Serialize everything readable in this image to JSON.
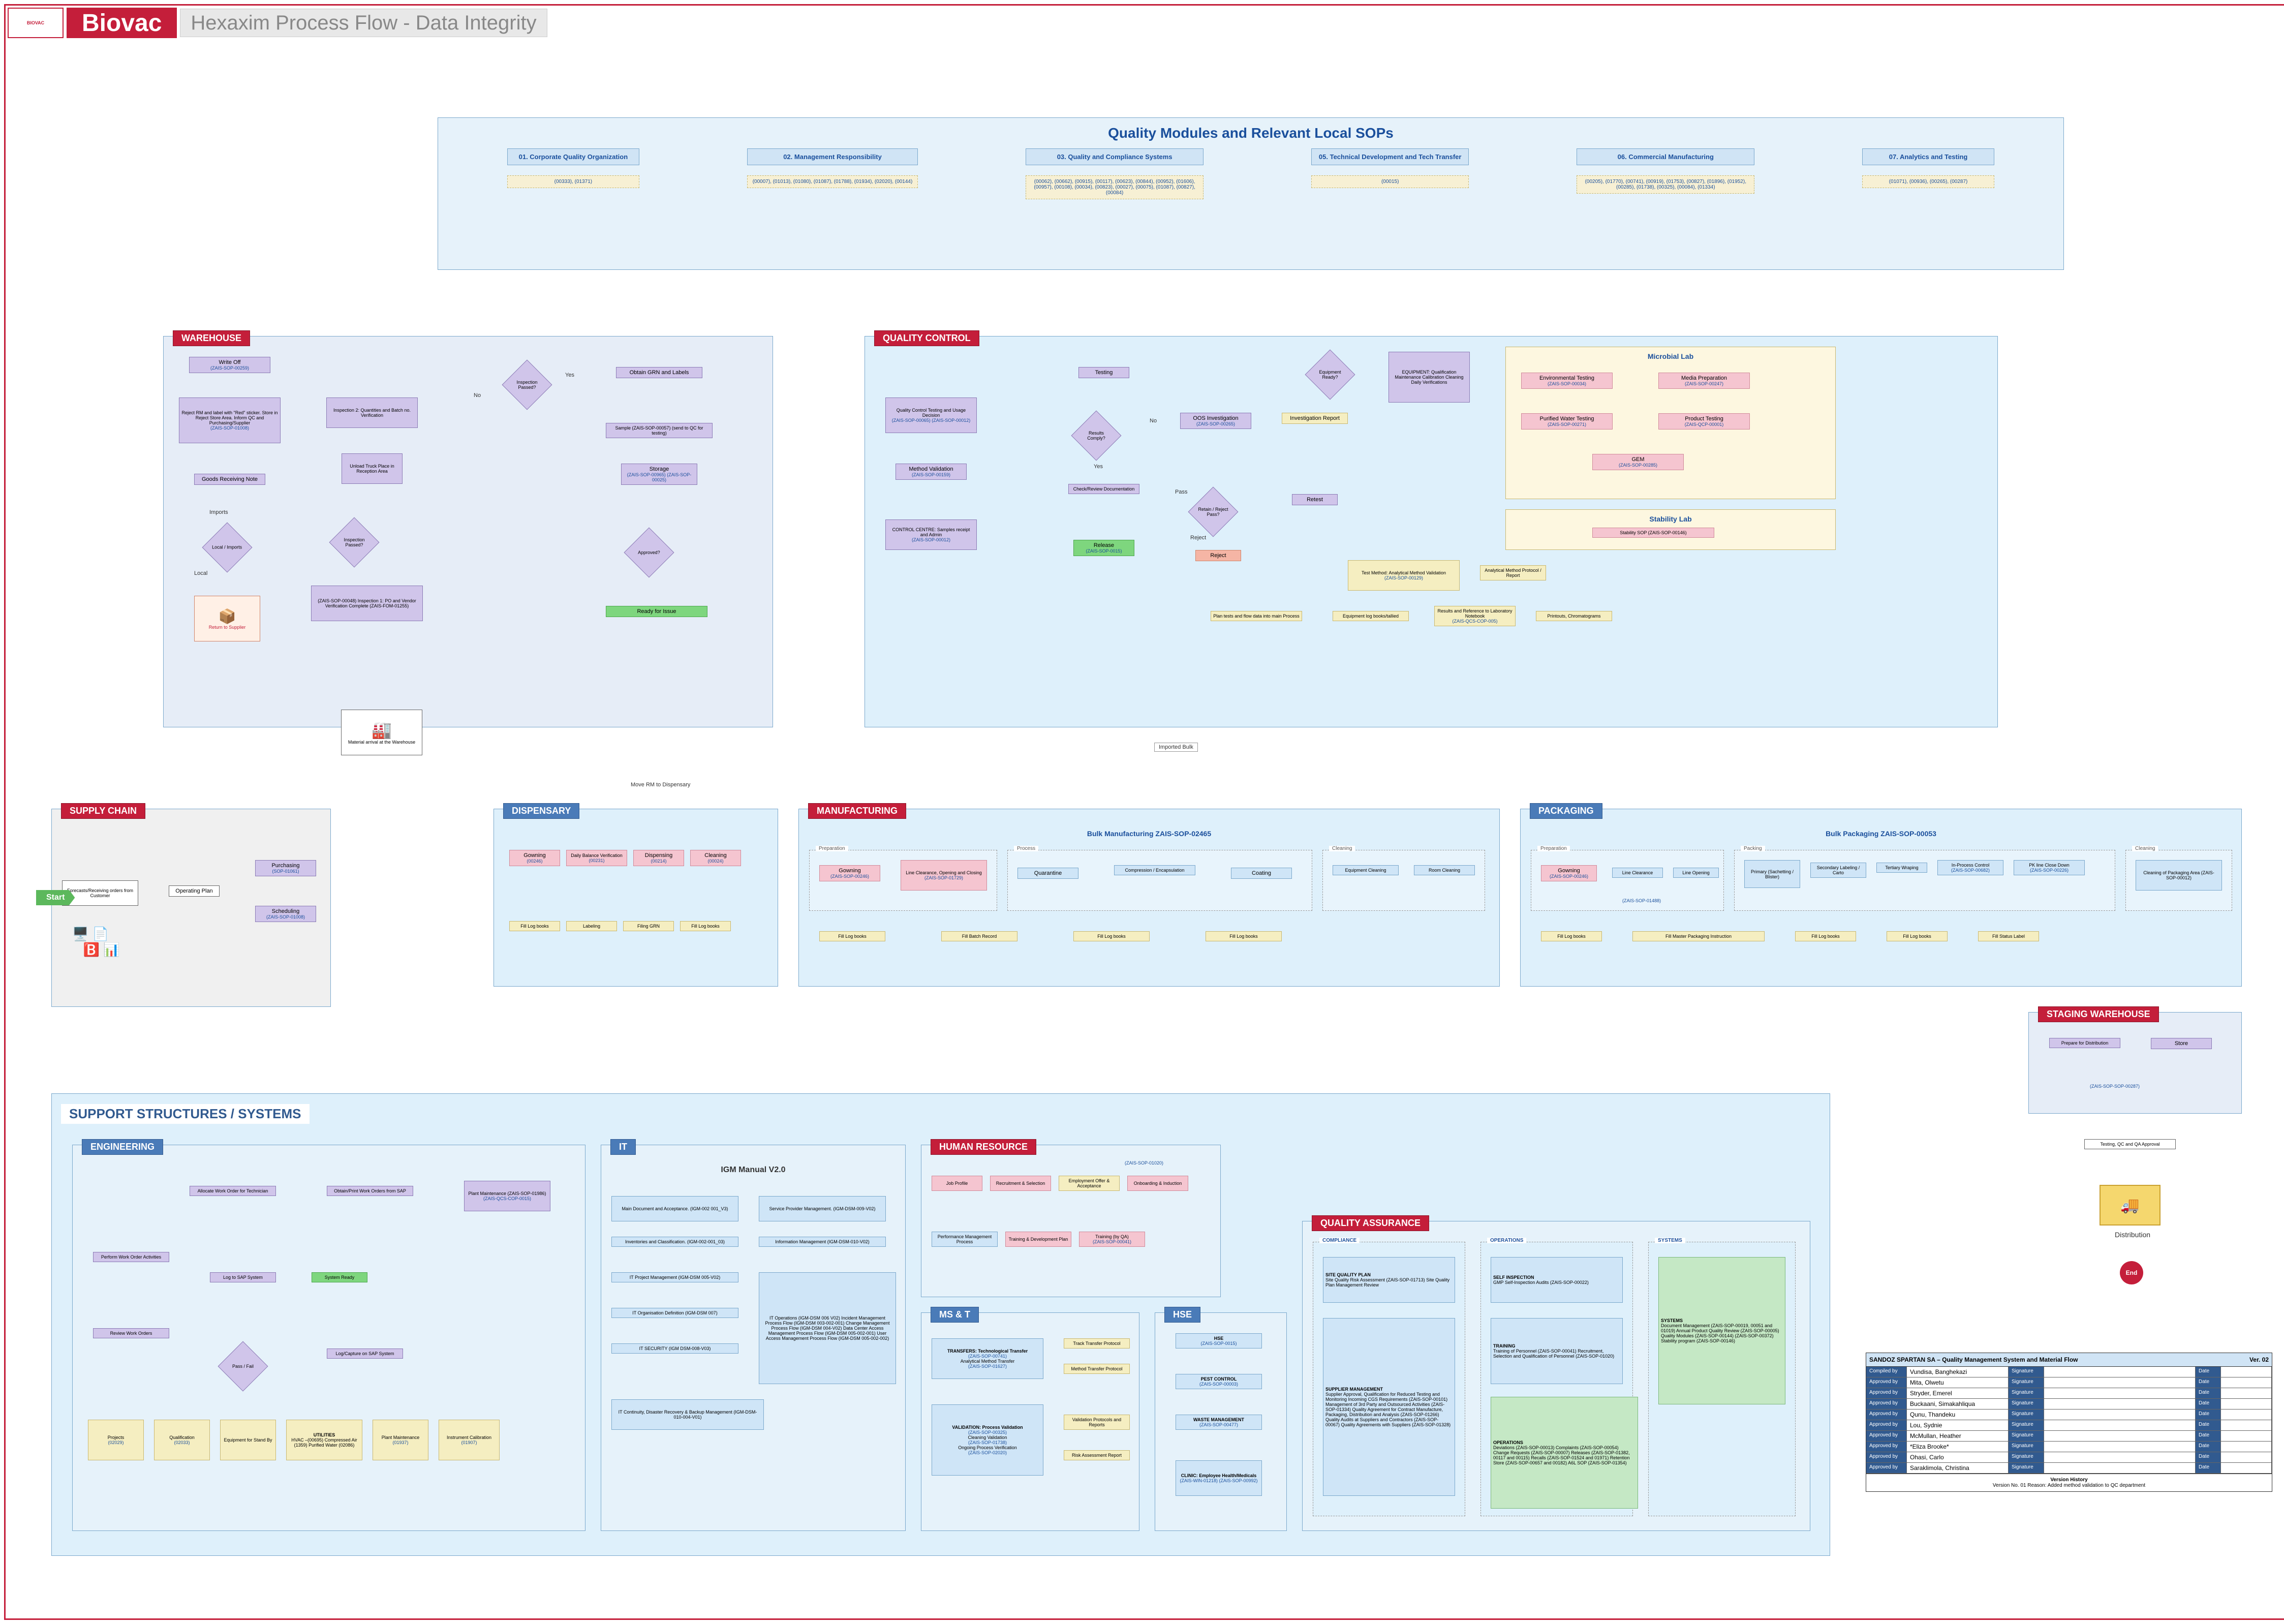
{
  "header": {
    "logo_text": "BIOVAC",
    "brand": "Biovac",
    "subtitle": "Hexaxim Process Flow - Data Integrity"
  },
  "qm": {
    "title": "Quality Modules and Relevant Local SOPs",
    "cols": [
      {
        "label": "01. Corporate Quality Organization",
        "sops": "(00333), (01371)"
      },
      {
        "label": "02. Management Responsibility",
        "sops": "(00007), (01013), (01080), (01087), (01788), (01934), (02020), (00144)"
      },
      {
        "label": "03. Quality and Compliance Systems",
        "sops": "(00062), (00662), (00915), (00117), (00623), (00844), (00952), (01606), (00957), (00108), (00034), (00823), (00027), (00075), (01087), (00827), (00084)"
      },
      {
        "label": "05. Technical Development and Tech Transfer",
        "sops": "(00015)"
      },
      {
        "label": "06. Commercial Manufacturing",
        "sops": "(00205), (01770), (00741), (00919), (01753), (00827), (01896), (01952), (00285), (01738), (00325), (00084), (01334)"
      },
      {
        "label": "07. Analytics and Testing",
        "sops": "(01071), (00936), (00265), (00287)"
      }
    ]
  },
  "areas": {
    "warehouse": "WAREHOUSE",
    "qc": "QUALITY CONTROL",
    "sc": "SUPPLY CHAIN",
    "disp": "DISPENSARY",
    "manu": "MANUFACTURING",
    "pkg": "PACKAGING",
    "stgwh": "STAGING WAREHOUSE",
    "support": "SUPPORT STRUCTURES / SYSTEMS",
    "eng": "ENGINEERING",
    "it": "IT",
    "hr": "HUMAN RESOURCE",
    "mst": "MS & T",
    "hse": "HSE",
    "qa": "QUALITY ASSURANCE"
  },
  "warehouse": {
    "writeoff": "Write Off",
    "writeoff_sop": "(ZAIS-SOP-00259)",
    "reject": "Reject RM and label with \"Red\" sticker. Store in Reject Store Area. Inform QC and Purchasing/Supplier",
    "reject_sop": "(ZAIS-SOP-01008)",
    "insp2": "Inspection 2: Quantities and Batch no. Verification",
    "unload": "Unload Truck Place in Reception Area",
    "insp_dia": "Inspection Passed?",
    "insp2_dia": "Inspection Passed?",
    "obtain": "Obtain GRN and Labels",
    "sample": "Sample (ZAIS-SOP-00057) (send to QC for testing)",
    "storage": "Storage",
    "storage_sop": "(ZAIS-SOP-00965)\n(ZAIS-SOP-00025)",
    "approved_dia": "Approved?",
    "ready": "Ready for Issue",
    "grn": "Goods Receiving Note",
    "local_dia": "Local / Imports",
    "insp1": "(ZAIS-SOP-00048) Inspection 1: PO and Vendor Verification Complete (ZAIS-FOM-01255)",
    "return": "Return to Supplier",
    "material": "Material arrival at the Warehouse",
    "imports": "Imports",
    "local": "Local",
    "yes": "Yes",
    "no": "No",
    "move_rm": "Move RM to Dispensary"
  },
  "qc": {
    "qct": "Quality Control Testing and Usage Decision",
    "qct_sop": "(ZAIS-SOP-00065)\n(ZAIS-SOP-00012)",
    "mv": "Method Validation",
    "mv_sop": "(ZAIS-SOP-00159)",
    "cc": "CONTROL CENTRE: Samples receipt and Admin",
    "cc_sop": "(ZAIS-SOP-00012)",
    "testing": "Testing",
    "results_dia": "Results Comply?",
    "oos": "OOS Investigation",
    "oos_sop": "(ZAIS-SOP-00265)",
    "checkrev": "Check/Review Documentation",
    "release": "Release",
    "release_sop": "(ZAIS-SOP-0015)",
    "retain_dia": "Retain / Reject Pass?",
    "reject": "Reject",
    "retest": "Retest",
    "inv_rep": "Investigation Report",
    "equip_dia": "Equipment Ready?",
    "equip": "EQUIPMENT: Qualification Maintenance Calibration Cleaning Daily Verifications",
    "microbial": "Microbial Lab",
    "env": "Environmental Testing",
    "env_sop": "(ZAIS-SOP-00034)",
    "media": "Media Preparation",
    "media_sop": "(ZAIS-SOP-00247)",
    "water": "Purified Water Testing",
    "water_sop": "(ZAIS-SOP-00271)",
    "product": "Product Testing",
    "product_sop": "(ZAIS-QCP-00001)",
    "gem": "GEM",
    "gem_sop": "(ZAIS-SOP-00285)",
    "stability": "Stability Lab",
    "stab_sop": "Stability SOP (ZAIS-SOP-00146)",
    "tm": "Test Method: Analytical Method Validation",
    "tm_sop": "(ZAIS-SOP-00129)",
    "ampr": "Analytical Method Protocol / Report",
    "plcf": "Plan tests and flow data into main Process",
    "logtied": "Equipment log books/tallied",
    "resref": "Results and Reference to Laboratory Notebook",
    "resref_sop": "(ZAIS-QCS-COP-005)",
    "printouts": "Printouts, Chromatograms",
    "pass": "Pass",
    "reject_lbl": "Reject",
    "yes": "Yes",
    "no": "No",
    "imported_bulk": "Imported Bulk"
  },
  "sc": {
    "forecast": "Forecasts/Receiving orders from Customer",
    "op": "Operating Plan",
    "purch": "Purchasing",
    "purch_sop": "(SOP-01061)",
    "sched": "Scheduling",
    "sched_sop": "(ZAIS-SOP-01008)"
  },
  "disp": {
    "gowning": "Gowning",
    "gowning_sop": "(00246)",
    "bal": "Daily Balance Verification",
    "bal_sop": "(00231)",
    "disp": "Dispensing",
    "disp_sop": "(00214)",
    "clean": "Cleaning",
    "clean_sop": "(00024)",
    "logs": "Fill Log books",
    "label": "Labeling",
    "filing": "Filing GRN",
    "logs2": "Fill Log books"
  },
  "manu": {
    "title": "Bulk Manufacturing ZAIS-SOP-02465",
    "prep": "Preparation",
    "process": "Process",
    "cleaning": "Cleaning",
    "gowning": "Gowning",
    "gowning_sop": "(ZAIS-SOP-00246)",
    "lc": "Line Clearance, Opening and Closing",
    "lc_sop": "(ZAIS-SOP-01729)",
    "quar": "Quarantine",
    "press": "Compression / Encapsulation",
    "coat": "Coating",
    "eqclean": "Equipment Cleaning",
    "rmclean": "Room Cleaning",
    "logs": "Fill Log books",
    "batch": "Fill Batch Record",
    "logs2": "Fill Log books",
    "logs3": "Fill Log books"
  },
  "pkg": {
    "title": "Bulk Packaging ZAIS-SOP-00053",
    "prep": "Preparation",
    "packing": "Packing",
    "cleaning": "Cleaning",
    "gowning": "Gowning",
    "gowning_sop": "(ZAIS-SOP-00246)",
    "lc": "Line Clearance",
    "open": "Line Opening",
    "lc_sop": "(ZAIS-SOP-01488)",
    "primary": "Primary (Sachetting / Blister)",
    "secondary": "Secondary Labeling / Carto",
    "tertiary": "Tertiary Wraping",
    "ipc": "In-Process Control",
    "ipc_sop": "(ZAIS-SOP-00682)",
    "close": "PK line Close Down",
    "close_sop": "(ZAIS-SOP-00226)",
    "cleanpkg": "Cleaning of Packaging Area (ZAIS-SOP-00012)",
    "logs": "Fill Log books",
    "mpi": "Fill Master Packaging Instruction",
    "logs2": "Fill Log books",
    "logs3": "Fill Log books",
    "status": "Fill Status Label"
  },
  "stgwh": {
    "prep": "Prepare for Distribution",
    "store": "Store",
    "sop": "(ZAIS-SOP-SOP-00287)",
    "approval": "Testing, QC and QA Approval",
    "dist": "Distribution",
    "end": "End"
  },
  "eng": {
    "allocate": "Allocate Work Order for Technician",
    "obtain": "Obtain/Print Work Orders from SAP",
    "plan": "Plant Maintenance (ZAIS-SOP-01986)",
    "plan_sop": "(ZAIS-QCS-COP-0015)",
    "perform": "Perform Work Order Activities",
    "log": "Log to SAP System",
    "sysready": "System Ready",
    "review": "Review Work Orders",
    "pass_dia": "Pass / Fail",
    "capture": "Log/Capture on SAP System",
    "projects": "Projects",
    "projects_sop": "(02029)",
    "qual": "Qualification",
    "qual_sop": "(02033)",
    "equip": "Equipment for Stand By",
    "util": "UTILITIES",
    "util_detail": "HVAC –(00695) Compressed Air (1359) Purified Water (02086)",
    "pmaint": "Plant Maintenance",
    "pmaint_sop": "(01937)",
    "instcal": "Instrument Calibration",
    "instcal_sop": "(01907)"
  },
  "it": {
    "title": "IGM Manual V2.0",
    "main": "Main Document and Acceptance. (IGM-002 001_V3)",
    "spm": "Service Provider Management. (IGM-DSM-009-V02)",
    "inv": "Inventories and Classification. (IGM-002-001_03)",
    "info": "Information Management (IGM-DSM-010-V02)",
    "proj": "IT Project Management (IGM-DSM 005-V02)",
    "org": "IT Organisation Definition (IGM-DSM 007)",
    "sec": "IT SECURITY (IGM DSM-008-V03)",
    "ops": "IT Operations (IGM-DSM 006 V02) Incident Management Process Flow  (IGM-DSM 003-002-001) Change Management Process Flow (IGM-DSM 004-V02) Data Center Access Management Process Flow (IGM-DSM 005-002-001) User Access Management Process Flow (IGM-DSM 005-002-002)",
    "bcp": "IT Continuity, Disaster Recovery & Backup Management (IGM-DSM-010-004-V01)"
  },
  "hr": {
    "sop": "(ZAIS-SOP-01020)",
    "jp": "Job Profile",
    "rs": "Recruitment & Selection",
    "eo": "Employment Offer & Acceptance",
    "oi": "Onboarding & Induction",
    "pmp": "Performance Management Process",
    "tdp": "Training & Development Plan",
    "tq": "Training (by QA)",
    "tq_sop": "(ZAIS-SOP-00041)"
  },
  "mst": {
    "transfers": "TRANSFERS: Technological Transfer",
    "transfers_sop": "(ZAIS-SOP-00741)",
    "amt": "Analytical Method Transfer",
    "amt_sop": "(ZAIS-SOP-01627)",
    "vp": "Track Transfer Protocol",
    "mtp": "Method Transfer Protocol",
    "val": "VALIDATION: Process Validation",
    "val_sop": "(ZAIS-SOP-00325)",
    "cv": "Cleaning Validation",
    "cv_sop": "(ZAIS-SOP-01738)",
    "opv": "Ongoing Process Verification",
    "opv_sop": "(ZAIS-SOP-02020)",
    "vprot": "Validation Protocols and Reports",
    "rar": "Risk Assessment Report"
  },
  "hse": {
    "hse": "HSE",
    "hse_sop": "(ZAIS-SOP-0015)",
    "pest": "PEST CONTROL",
    "pest_sop": "(ZAIS-SOP-00003)",
    "waste": "WASTE MANAGEMENT",
    "waste_sop": "(ZAIS-SOP-00477)",
    "clinic": "CLINIC: Employee Health/Medicals",
    "clinic_sop": "(ZAIS-WIN-01218)\n(ZAIS-SOP-00992)"
  },
  "qa": {
    "compliance_hdr": "COMPLIANCE",
    "ops_hdr": "OPERATIONS",
    "sys_hdr": "SYSTEMS",
    "sqp": "SITE QUALITY PLAN",
    "sqp_items": "Site Quality Risk Assessment (ZAIS-SOP-01713)\nSite Quality Plan\nManagement Review",
    "sm": "SUPPLIER MANAGEMENT",
    "sm_items": "Supplier Approval, Qualification for Reduced Testing and Monitoring Incoming CGS Requirements (ZAIS-SOP-00101)\nManagement of 3rd Party and Outsourced Activities (ZAIS-SOP-01334)\nQuality Agreement for Contract Manufacture, Packaging, Distribution and Analysis (ZAIS-SOP-01266)\nQuality Audits at Suppliers and Contractors (ZAIS-SOP-00067)\nQuality Agreements with Suppliers (ZAIS-SOP-01328)",
    "si": "SELF INSPECTION",
    "si_items": "GMP Self-Inspection Audits (ZAIS-SOP-00022)",
    "train": "TRAINING",
    "train_items": "Training of Personnel (ZAIS-SOP-00041) Recruitment, Selection and Qualification of Personnel (ZAIS-SOP-01020)",
    "ops": "OPERATIONS",
    "ops_items": "Deviations (ZAIS-SOP-00013) Complaints (ZAIS-SOP-00054) Change Requests (ZAIS-SOP-00007) Releases (ZAIS-SOP-01382, 00117 and 00115) Recalls (ZAIS-SOP-01524 and 01971) Retention Store (ZAIS-SOP-00657 and 00182) A6L SOP (ZAIS-SOP-01354)",
    "sys": "SYSTEMS",
    "sys_items": "Document Management (ZAIS-SOP-00019, 00051 and 01019) Annual Product Quality Review (ZAIS-SOP-00005) Quality Modules (ZAIS-SOP-00144) (ZAIS-SOP-00372) Stability program (ZAIS-SOP-00146)"
  },
  "table": {
    "title": "SANDOZ SPARTAN  SA – Quality Management System and Material Flow",
    "ver": "Ver. 02",
    "rows": [
      {
        "c1": "Compiled by",
        "c2": "Vundisa, Banghekazi",
        "c3": "Signature",
        "c4": "",
        "c5": "Date",
        "c6": ""
      },
      {
        "c1": "Approved by",
        "c2": "Mita, Olwetu",
        "c3": "Signature",
        "c4": "",
        "c5": "Date",
        "c6": ""
      },
      {
        "c1": "Approved by",
        "c2": "Stryder, Emerel",
        "c3": "Signature",
        "c4": "",
        "c5": "Date",
        "c6": ""
      },
      {
        "c1": "Approved by",
        "c2": "Buckaani, Simakahliqua",
        "c3": "Signature",
        "c4": "",
        "c5": "Date",
        "c6": ""
      },
      {
        "c1": "Approved by",
        "c2": "Qunu, Thandeku",
        "c3": "Signature",
        "c4": "",
        "c5": "Date",
        "c6": ""
      },
      {
        "c1": "Approved by",
        "c2": "Lou, Sydnie",
        "c3": "Signature",
        "c4": "",
        "c5": "Date",
        "c6": ""
      },
      {
        "c1": "Approved by",
        "c2": "McMullan, Heather",
        "c3": "Signature",
        "c4": "",
        "c5": "Date",
        "c6": ""
      },
      {
        "c1": "Approved by",
        "c2": "*Eliza Brooke*",
        "c3": "Signature",
        "c4": "",
        "c5": "Date",
        "c6": ""
      },
      {
        "c1": "Approved by",
        "c2": "Ohasi, Carlo",
        "c3": "Signature",
        "c4": "",
        "c5": "Date",
        "c6": ""
      },
      {
        "c1": "Approved by",
        "c2": "Saraklimola, Christina",
        "c3": "Signature",
        "c4": "",
        "c5": "Date",
        "c6": ""
      }
    ],
    "footer_title": "Version History",
    "footer": "Version No. 01   Reason: Added method validation to QC department"
  },
  "start": "Start"
}
